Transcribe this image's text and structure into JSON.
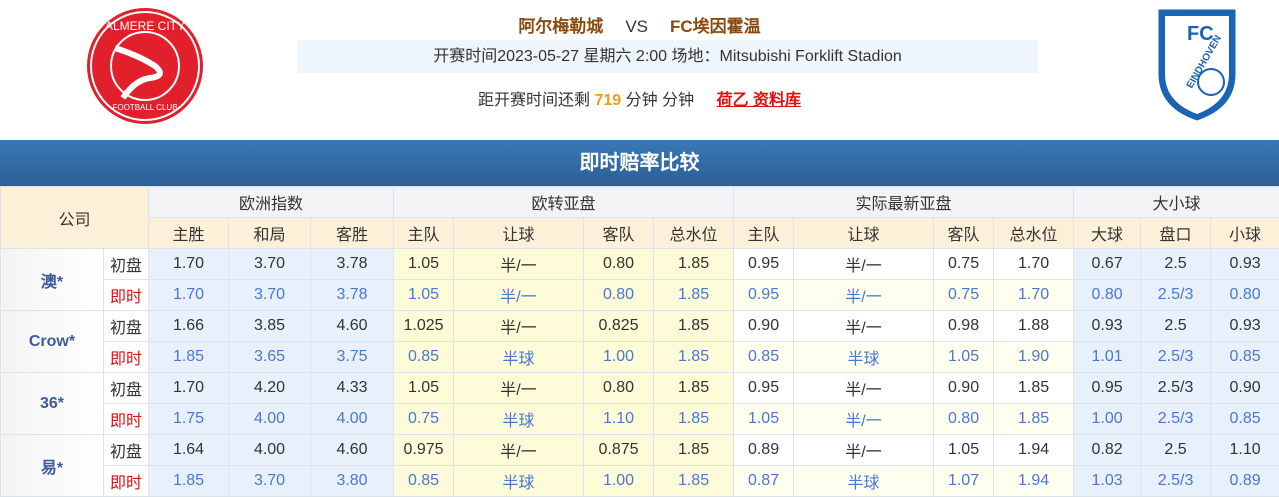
{
  "header": {
    "home": "阿尔梅勒城",
    "vs": "VS",
    "away": "FC埃因霍温",
    "info": "开赛时间2023-05-27 星期六 2:00  场地：Mitsubishi Forklift Stadion",
    "countdown_prefix": "距开赛时间还剩",
    "countdown_value": "719",
    "countdown_suffix": "分钟 分钟",
    "league_link": "荷乙 资料库",
    "home_logo_text": "ALMERE CITY FOOTBALL CLUB",
    "away_logo_text": "FC EINDHOVEN"
  },
  "title": "即时赔率比较",
  "table": {
    "company_header": "公司",
    "groups": [
      "欧洲指数",
      "欧转亚盘",
      "实际最新亚盘",
      "大小球"
    ],
    "subheaders": [
      "主胜",
      "和局",
      "客胜",
      "主队",
      "让球",
      "客队",
      "总水位",
      "主队",
      "让球",
      "客队",
      "总水位",
      "大球",
      "盘口",
      "小球"
    ],
    "companies": [
      {
        "name": "澳*",
        "rows": [
          {
            "label": "初盘",
            "values": [
              "1.70",
              "3.70",
              "3.78",
              "1.05",
              "半/一",
              "0.80",
              "1.85",
              "0.95",
              "半/一",
              "0.75",
              "1.70",
              "0.67",
              "2.5",
              "0.93"
            ]
          },
          {
            "label": "即时",
            "values": [
              "1.70",
              "3.70",
              "3.78",
              "1.05",
              "半/一",
              "0.80",
              "1.85",
              "0.95",
              "半/一",
              "0.75",
              "1.70",
              "0.80",
              "2.5/3",
              "0.80"
            ]
          }
        ]
      },
      {
        "name": "Crow*",
        "rows": [
          {
            "label": "初盘",
            "values": [
              "1.66",
              "3.85",
              "4.60",
              "1.025",
              "半/一",
              "0.825",
              "1.85",
              "0.90",
              "半/一",
              "0.98",
              "1.88",
              "0.93",
              "2.5",
              "0.93"
            ]
          },
          {
            "label": "即时",
            "values": [
              "1.85",
              "3.65",
              "3.75",
              "0.85",
              "半球",
              "1.00",
              "1.85",
              "0.85",
              "半球",
              "1.05",
              "1.90",
              "1.01",
              "2.5/3",
              "0.85"
            ]
          }
        ]
      },
      {
        "name": "36*",
        "rows": [
          {
            "label": "初盘",
            "values": [
              "1.70",
              "4.20",
              "4.33",
              "1.05",
              "半/一",
              "0.80",
              "1.85",
              "0.95",
              "半/一",
              "0.90",
              "1.85",
              "0.95",
              "2.5/3",
              "0.90"
            ]
          },
          {
            "label": "即时",
            "values": [
              "1.75",
              "4.00",
              "4.00",
              "0.75",
              "半球",
              "1.10",
              "1.85",
              "1.05",
              "半/一",
              "0.80",
              "1.85",
              "1.00",
              "2.5/3",
              "0.85"
            ]
          }
        ]
      },
      {
        "name": "易*",
        "rows": [
          {
            "label": "初盘",
            "values": [
              "1.64",
              "4.00",
              "4.60",
              "0.975",
              "半/一",
              "0.875",
              "1.85",
              "0.89",
              "半/一",
              "1.05",
              "1.94",
              "0.82",
              "2.5",
              "1.10"
            ]
          },
          {
            "label": "即时",
            "values": [
              "1.85",
              "3.70",
              "3.80",
              "0.85",
              "半球",
              "1.00",
              "1.85",
              "0.87",
              "半球",
              "1.07",
              "1.94",
              "1.03",
              "2.5/3",
              "0.89"
            ]
          }
        ]
      }
    ]
  }
}
